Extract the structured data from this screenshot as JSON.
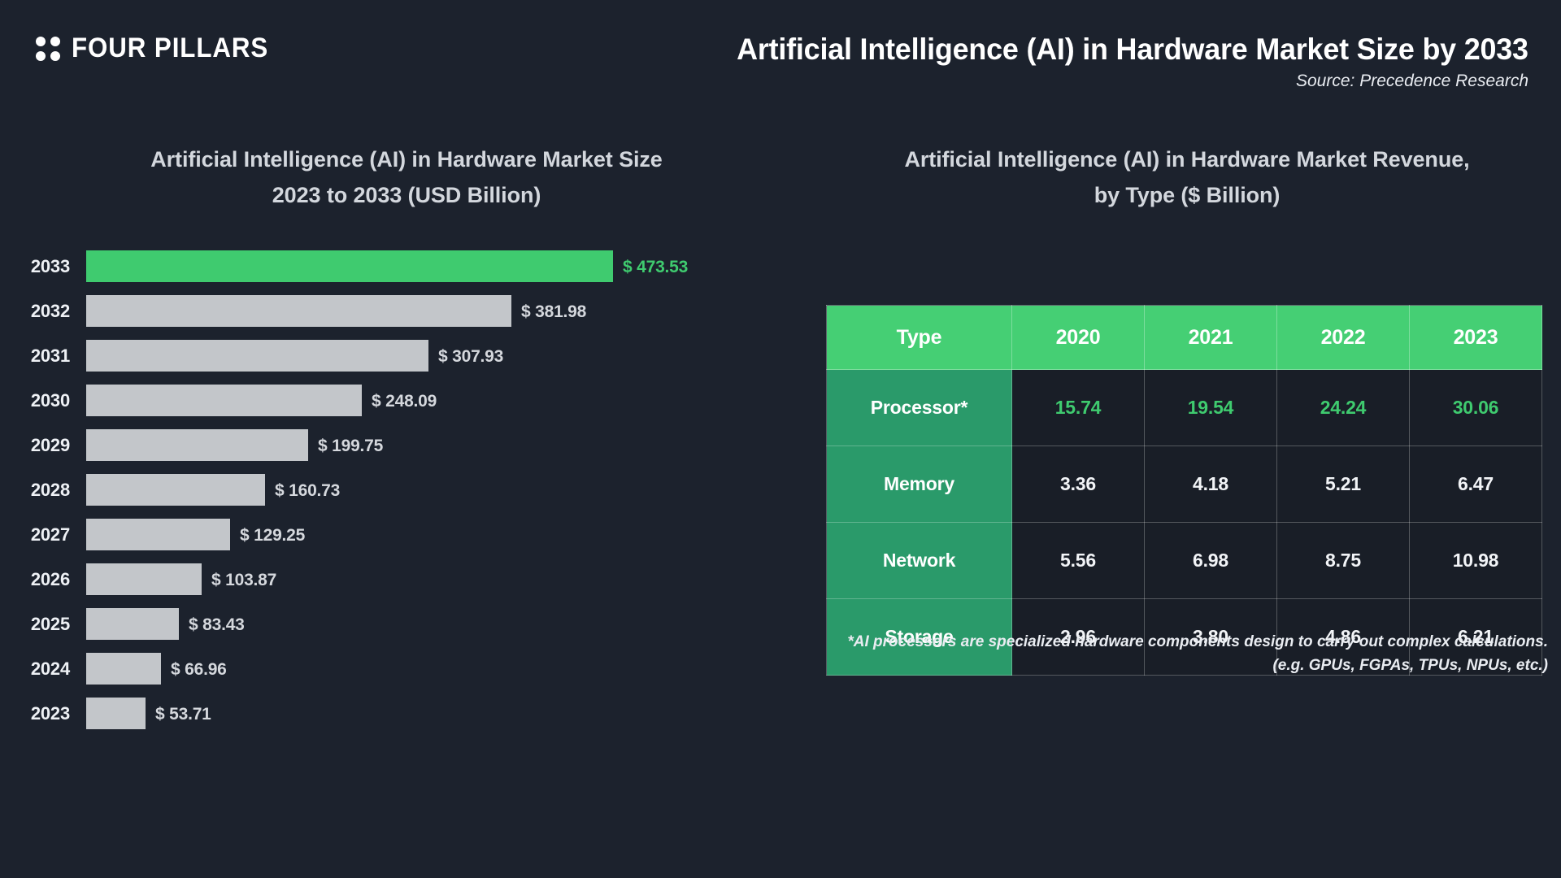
{
  "header": {
    "logo_text": "FOUR PILLARS",
    "logo_icon": "four-dots-icon",
    "title": "Artificial Intelligence (AI) in Hardware Market Size by 2033",
    "source": "Source: Precedence Research"
  },
  "colors": {
    "background": "#1c222d",
    "accent_green": "#3fcb6f",
    "header_green": "#45cf74",
    "row_green": "#2a9a6a",
    "bar_gray": "#c3c6ca",
    "cell_background": "#191e27",
    "title_gray": "#d3d7dd"
  },
  "left_panel": {
    "title_line1": "Artificial Intelligence (AI) in Hardware Market Size",
    "title_line2": "2023 to 2033 (USD Billion)"
  },
  "right_panel": {
    "title_line1": "Artificial Intelligence (AI) in Hardware Market Revenue,",
    "title_line2": "by Type ($ Billion)",
    "footnote_line1": "*AI processors are specialized hardware components design to carry out complex calculations.",
    "footnote_line2": "(e.g. GPUs, FGPAs, TPUs, NPUs, etc.)"
  },
  "chart_data": [
    {
      "type": "bar",
      "orientation": "horizontal",
      "title": "Artificial Intelligence (AI) in Hardware Market Size 2023 to 2033 (USD Billion)",
      "xlabel": "",
      "ylabel": "",
      "grid": false,
      "legend": "none",
      "xlim": [
        0,
        473.53
      ],
      "unit": "USD Billion",
      "value_prefix": "$ ",
      "highlight_category": "2033",
      "categories": [
        "2033",
        "2032",
        "2031",
        "2030",
        "2029",
        "2028",
        "2027",
        "2026",
        "2025",
        "2024",
        "2023"
      ],
      "values": [
        473.53,
        381.98,
        307.93,
        248.09,
        199.75,
        160.73,
        129.25,
        103.87,
        83.43,
        66.96,
        53.71
      ],
      "value_labels": [
        "$ 473.53",
        "$ 381.98",
        "$ 307.93",
        "$ 248.09",
        "$ 199.75",
        "$ 160.73",
        "$ 129.25",
        "$ 103.87",
        "$ 83.43",
        "$ 66.96",
        "$ 53.71"
      ]
    },
    {
      "type": "table",
      "title": "Artificial Intelligence (AI) in Hardware Market Revenue, by Type ($ Billion)",
      "unit": "$ Billion",
      "columns": [
        "Type",
        "2020",
        "2021",
        "2022",
        "2023"
      ],
      "rows": [
        {
          "label": "Processor*",
          "values": [
            "15.74",
            "19.54",
            "24.24",
            "30.06"
          ],
          "highlight": true
        },
        {
          "label": "Memory",
          "values": [
            "3.36",
            "4.18",
            "5.21",
            "6.47"
          ],
          "highlight": false
        },
        {
          "label": "Network",
          "values": [
            "5.56",
            "6.98",
            "8.75",
            "10.98"
          ],
          "highlight": false
        },
        {
          "label": "Storage",
          "values": [
            "2.96",
            "3.80",
            "4.86",
            "6.21"
          ],
          "highlight": false
        }
      ]
    }
  ]
}
